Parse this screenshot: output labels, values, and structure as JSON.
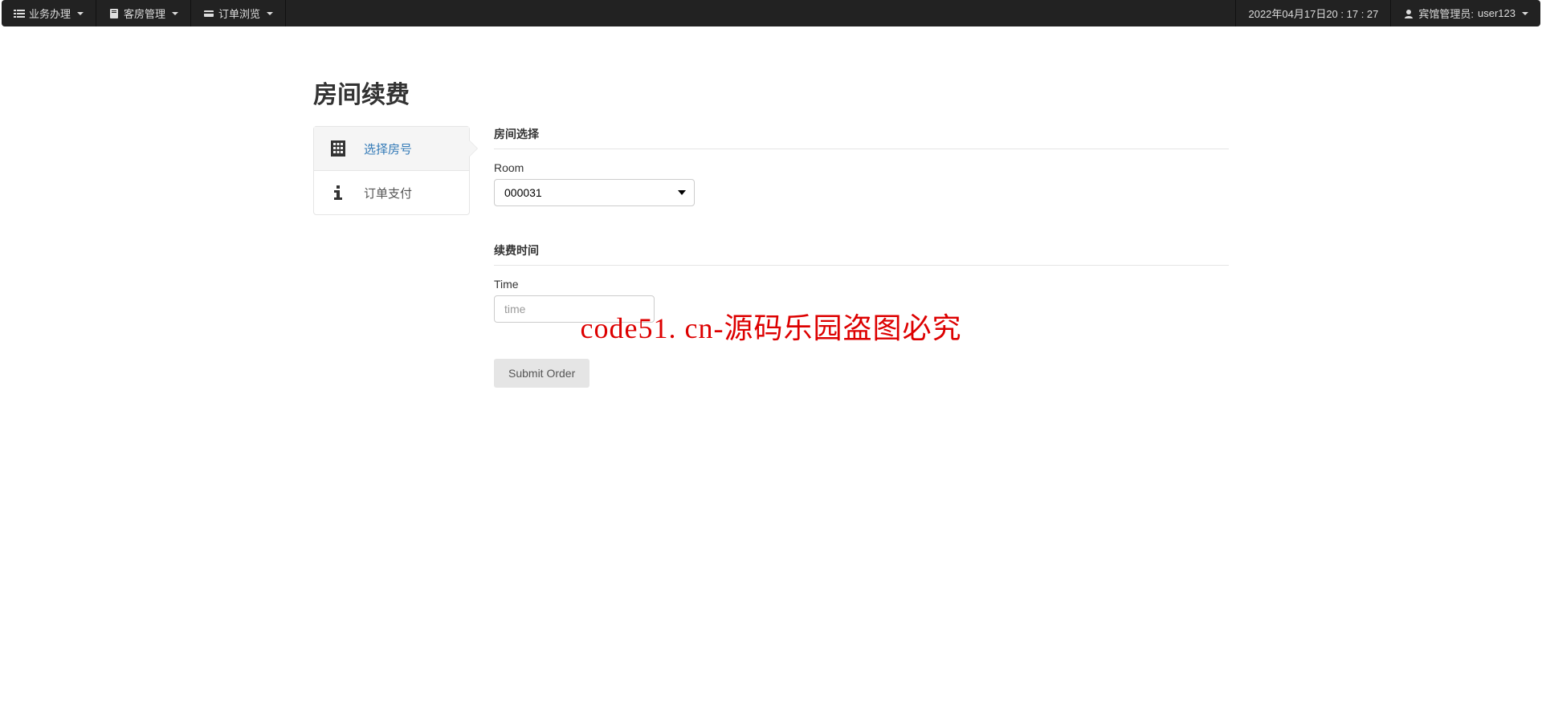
{
  "navbar": {
    "items": [
      {
        "label": "业务办理"
      },
      {
        "label": "客房管理"
      },
      {
        "label": "订单浏览"
      }
    ],
    "datetime": "2022年04月17日20 : 17 : 27",
    "user_prefix": "宾馆管理员: ",
    "user_name": "user123"
  },
  "page": {
    "title": "房间续费"
  },
  "wizard": {
    "steps": [
      {
        "label": "选择房号",
        "active": true
      },
      {
        "label": "订单支付",
        "active": false
      }
    ]
  },
  "form": {
    "section_room": "房间选择",
    "room_label": "Room",
    "room_value": "000031",
    "section_time": "续费时间",
    "time_label": "Time",
    "time_placeholder": "time",
    "submit_label": "Submit Order"
  },
  "watermark": "code51. cn-源码乐园盗图必究"
}
